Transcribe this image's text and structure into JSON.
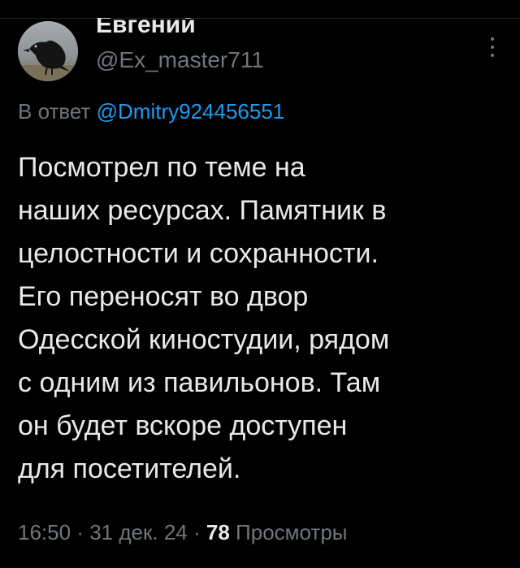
{
  "tweet": {
    "author": {
      "name": "Евгений",
      "handle": "@Ex_master711",
      "avatar_icon": "crow-avatar"
    },
    "reply": {
      "prefix": "В ответ",
      "mention": "@Dmitry924456551"
    },
    "text_lines": [
      "Посмотрел по теме на",
      "наших ресурсах. Памятник в",
      "целостности и сохранности.",
      "Его переносят во двор",
      "Одесской киностудии, рядом",
      "с одним из павильонов. Там",
      "он будет вскоре доступен",
      "для посетителей."
    ],
    "meta": {
      "time": "16:50",
      "separator": "·",
      "date": "31 дек. 24",
      "views_count": "78",
      "views_label": "Просмотры"
    },
    "more_icon": "more-vertical-icon"
  },
  "colors": {
    "background": "#000000",
    "primary_text": "#e7e9ea",
    "secondary_text": "#71767b",
    "accent": "#1d9bf0"
  }
}
